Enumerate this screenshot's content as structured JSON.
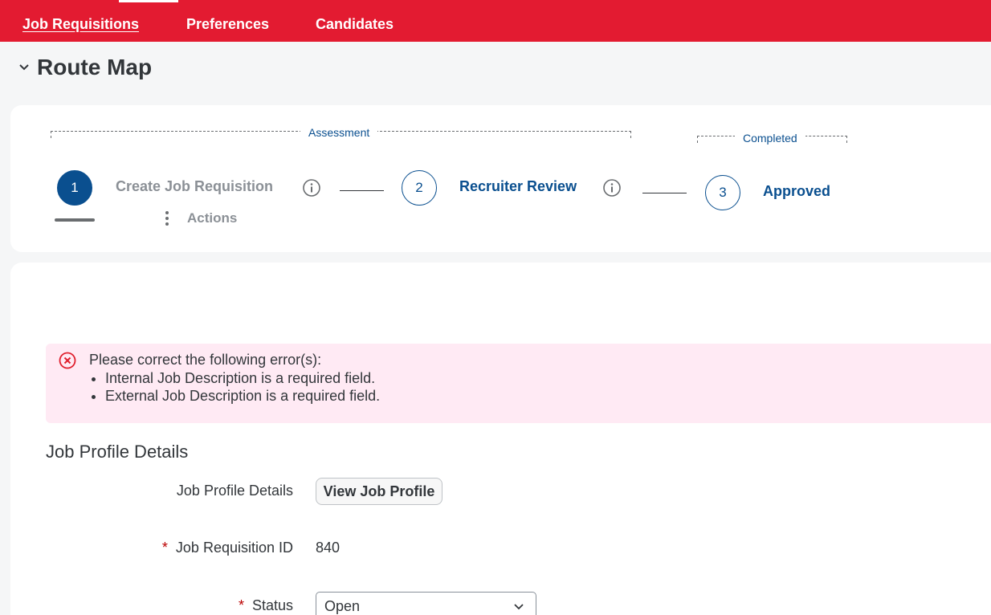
{
  "topnav": {
    "items": [
      {
        "label": "Job Requisitions",
        "active": true
      },
      {
        "label": "Preferences",
        "active": false
      },
      {
        "label": "Candidates",
        "active": false
      }
    ]
  },
  "route_map": {
    "title": "Route Map",
    "groups": [
      {
        "label": "Assessment"
      },
      {
        "label": "Completed"
      }
    ],
    "steps": [
      {
        "number": "1",
        "label": "Create Job Requisition",
        "status": "current",
        "actions_label": "Actions"
      },
      {
        "number": "2",
        "label": "Recruiter Review",
        "status": "upcoming"
      },
      {
        "number": "3",
        "label": "Approved",
        "status": "upcoming"
      }
    ]
  },
  "error": {
    "title": "Please correct the following error(s):",
    "items": [
      "Internal Job Description is a required field.",
      "External Job Description is a required field."
    ]
  },
  "form": {
    "section_title": "Job Profile Details",
    "job_profile": {
      "label": "Job Profile Details",
      "button_label": "View Job Profile"
    },
    "requisition_id": {
      "label": "Job Requisition ID",
      "value": "840",
      "required": true
    },
    "status": {
      "label": "Status",
      "value": "Open",
      "required": true
    }
  },
  "colors": {
    "brand_red": "#e31b31",
    "link_blue": "#0a4f8f",
    "error_bg": "#ffeaf4",
    "error_red": "#e0202e"
  }
}
